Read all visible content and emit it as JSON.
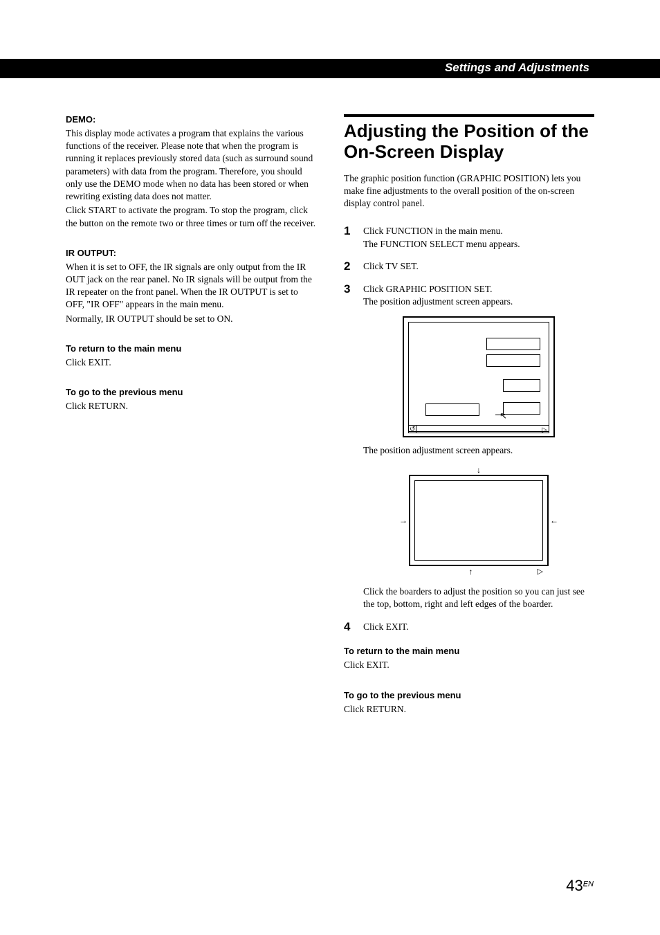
{
  "header": {
    "title": "Settings and Adjustments"
  },
  "left": {
    "demo": {
      "heading": "DEMO:",
      "p1": "This display mode activates a program that explains the various functions of the receiver. Please note that when the program is running it replaces previously stored data (such as surround sound parameters) with data from the program. Therefore, you should only use the DEMO mode when no data has been stored or when rewriting existing data does not matter.",
      "p2": "Click START to activate the program. To stop the program, click the button on the remote two or three times or turn off the receiver."
    },
    "ir": {
      "heading": "IR OUTPUT:",
      "p1": "When it is set to OFF, the IR signals are only output from the IR OUT jack on the rear panel. No IR signals will be output from the IR repeater on the front panel. When the IR OUTPUT is set to OFF, \"IR OFF\" appears in the main menu.",
      "p2": "Normally, IR OUTPUT should be set to ON."
    },
    "return_main": {
      "heading": "To return to the main menu",
      "body": "Click EXIT."
    },
    "go_prev": {
      "heading": "To go to the previous menu",
      "body": "Click RETURN."
    }
  },
  "right": {
    "title": "Adjusting the Position of the On-Screen Display",
    "intro": "The graphic position function (GRAPHIC POSITION) lets you make fine adjustments to the overall position of the on-screen display control panel.",
    "steps": {
      "s1a": "Click FUNCTION in the main menu.",
      "s1b": "The FUNCTION SELECT menu appears.",
      "s2": "Click TV SET.",
      "s3a": "Click GRAPHIC POSITION SET.",
      "s3b": "The position adjustment screen appears.",
      "after_fig1": "The position adjustment screen appears.",
      "after_fig2": "Click the boarders to adjust the position so you can just see the top, bottom, right and left edges of the boarder.",
      "s4": "Click EXIT."
    },
    "return_main": {
      "heading": "To return to the main menu",
      "body": "Click EXIT."
    },
    "go_prev": {
      "heading": "To go to the previous menu",
      "body": "Click RETURN."
    },
    "diagram1": {
      "bar_left": "↺",
      "bar_right": "▷",
      "cursor": "↖"
    },
    "diagram2": {
      "arrow_t": "↓",
      "arrow_b": "↑",
      "arrow_l": "→",
      "arrow_r": "←",
      "exit": "▷"
    }
  },
  "page": {
    "num": "43",
    "suffix": "EN"
  }
}
